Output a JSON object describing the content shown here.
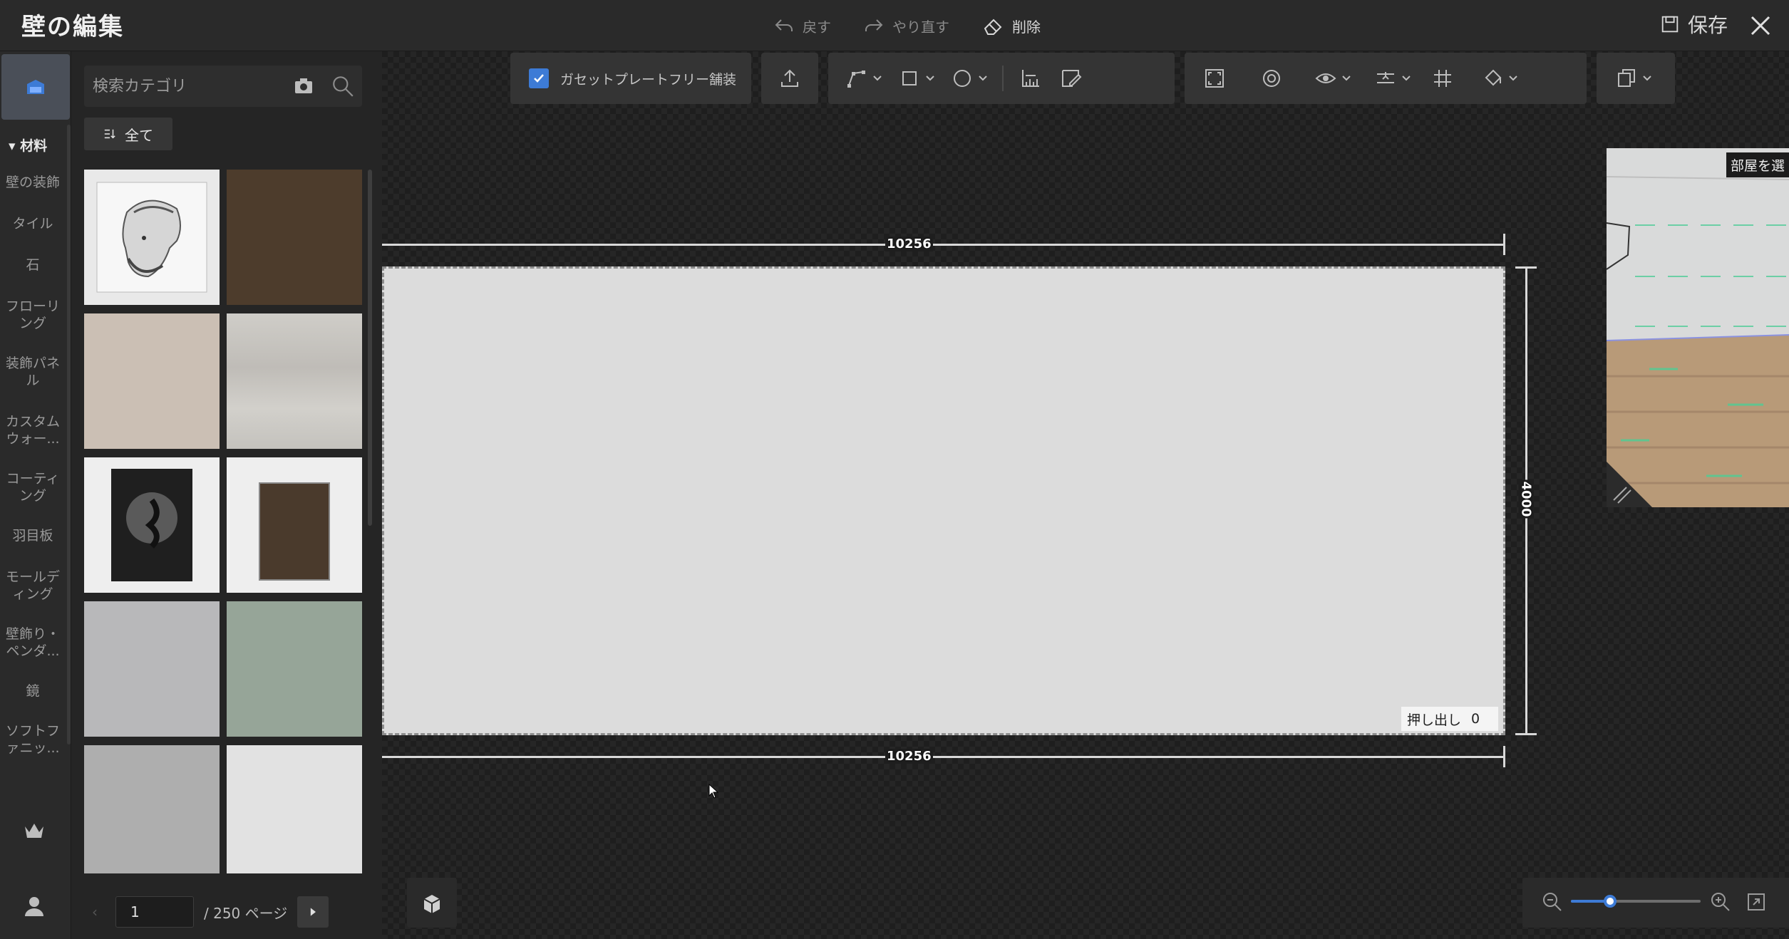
{
  "header": {
    "title": "壁の編集",
    "undo_label": "戻す",
    "redo_label": "やり直す",
    "delete_label": "削除",
    "save_label": "保存"
  },
  "rail": {
    "section_label": "材料",
    "items": [
      {
        "label": "壁の装飾"
      },
      {
        "label": "タイル"
      },
      {
        "label": "石"
      },
      {
        "label": "フローリング"
      },
      {
        "label": "装飾パネル"
      },
      {
        "label": "カスタムウォー..."
      },
      {
        "label": "コーティング"
      },
      {
        "label": "羽目板"
      },
      {
        "label": "モールディング"
      },
      {
        "label": "壁飾り・ペンダ..."
      },
      {
        "label": "鏡"
      },
      {
        "label": "ソフトファニッ..."
      }
    ]
  },
  "panel": {
    "search_placeholder": "検索カテゴリ",
    "filter_label": "全て",
    "materials": [
      {
        "name": "sketch-portrait",
        "color": "#e9e9e9"
      },
      {
        "name": "dark-wood",
        "color": "#4d3c2c"
      },
      {
        "name": "beige-plaster",
        "color": "#cbbfb4"
      },
      {
        "name": "light-wood",
        "color": "#c8c6c1"
      },
      {
        "name": "dark-frame-art",
        "color": "#eeeeee"
      },
      {
        "name": "brown-panel-art",
        "color": "#eeeeee"
      },
      {
        "name": "grey-concrete",
        "color": "#b8b8ba"
      },
      {
        "name": "sage-green",
        "color": "#96a598"
      },
      {
        "name": "mid-grey",
        "color": "#aeaeae"
      },
      {
        "name": "light-grey",
        "color": "#e2e2e2"
      }
    ],
    "page_current": "1",
    "page_total_label": "/ 250 ページ"
  },
  "toolbar": {
    "gusset_label": "ガセットプレートフリー舗装",
    "gusset_checked": true
  },
  "canvas": {
    "width_top": "10256",
    "width_bottom": "10256",
    "height": "4000",
    "extrude_label": "押し出し",
    "extrude_value": "0"
  },
  "preview": {
    "label": "部屋を選"
  },
  "zoom": {
    "level": 0.3
  },
  "colors": {
    "accent": "#3d7bd6",
    "wall": "#dcdcdc",
    "background": "#1e1e1e"
  }
}
